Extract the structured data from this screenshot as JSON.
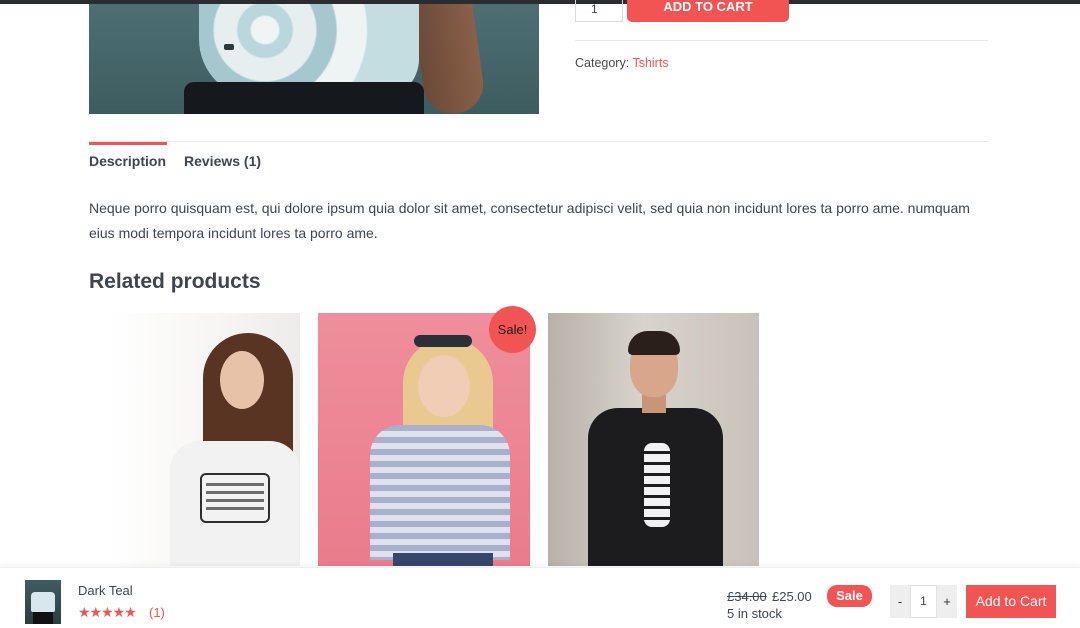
{
  "product": {
    "quantity": "1",
    "add_to_cart_label": "ADD TO CART",
    "category_label": "Category:",
    "category_value": "Tshirts"
  },
  "tabs": [
    {
      "label": "Description",
      "active": true
    },
    {
      "label": "Reviews (1)",
      "active": false
    }
  ],
  "description": {
    "text": "Neque porro quisquam est, qui dolore ipsum quia dolor sit amet, consectetur adipisci velit, sed quia non incidunt lores ta porro ame. numquam eius modi tempora incidunt lores ta porro ame."
  },
  "related": {
    "title": "Related products",
    "sale_badge": "Sale!"
  },
  "sticky_bar": {
    "product_name": "Dark Teal",
    "stars": "★★★★★",
    "rating": 5,
    "review_count": "(1)",
    "old_price": "£34.00",
    "new_price": "£25.00",
    "stock": "5 in stock",
    "sale_label": "Sale",
    "minus": "-",
    "quantity": "1",
    "plus": "+",
    "add_to_cart": "Add to Cart"
  },
  "colors": {
    "accent": "#f25454",
    "text": "#3e4550"
  }
}
